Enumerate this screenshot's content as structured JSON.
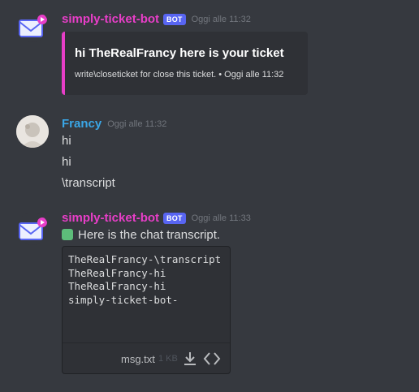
{
  "messages": [
    {
      "author": "simply-ticket-bot",
      "badge": "BOT",
      "timestamp": "Oggi alle 11:32",
      "embed": {
        "title": "hi TheRealFrancy here is your ticket",
        "footer": "write\\closeticket for close this ticket. • Oggi alle 11:32"
      }
    },
    {
      "author": "Francy",
      "timestamp": "Oggi alle 11:32",
      "lines": [
        "hi",
        "hi",
        "\\transcript"
      ]
    },
    {
      "author": "simply-ticket-bot",
      "badge": "BOT",
      "timestamp": "Oggi alle 11:33",
      "text": "Here is the chat transcript.",
      "attachment": {
        "preview": "TheRealFrancy-\\transcript\nTheRealFrancy-hi\nTheRealFrancy-hi\nsimply-ticket-bot-",
        "filename": "msg.txt",
        "size": "1 KB",
        "icons": [
          "download-icon",
          "code-view-icon"
        ]
      }
    }
  ],
  "colors": {
    "background": "#36393f",
    "bot_name": "#e83ec8",
    "user_name": "#3aa6e6",
    "badge": "#5865f2",
    "embed_accent": "#e83ec8"
  }
}
